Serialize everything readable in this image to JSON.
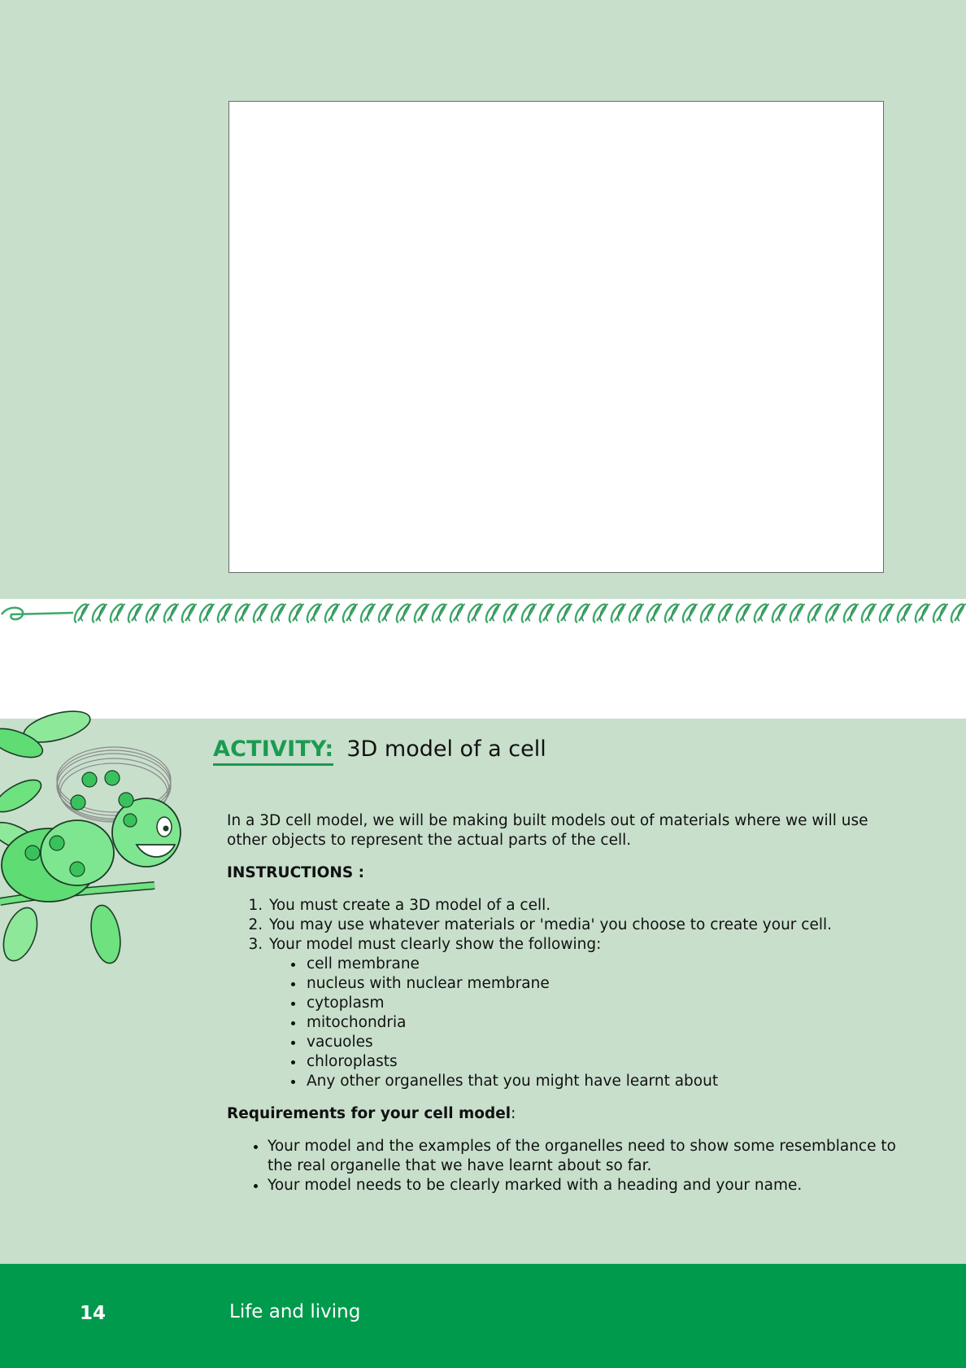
{
  "activity": {
    "label": "ACTIVITY:",
    "title": "3D model of a cell"
  },
  "intro": "In a 3D cell model, we will be making built models out of materials where we will use other objects to represent the actual parts of the cell.",
  "instructions": {
    "heading": "INSTRUCTIONS :",
    "steps": [
      "You must create a 3D model of a cell.",
      "You may use whatever materials or 'media' you choose to create your cell.",
      "Your model must clearly show the following:"
    ],
    "parts": [
      "cell membrane",
      "nucleus with nuclear membrane",
      "cytoplasm",
      "mitochondria",
      "vacuoles",
      "chloroplasts",
      "Any other organelles that you might have learnt about"
    ]
  },
  "requirements": {
    "heading": "Requirements for your cell model",
    "colon": ":",
    "items": [
      "Your model and the examples of the organelles need to show some resemblance to the real organelle that we have learnt about so far.",
      "Your model needs to be clearly marked with a heading and your name."
    ]
  },
  "footer": {
    "page_number": "14",
    "title": "Life and living"
  },
  "colors": {
    "panel_background": "#c8dfcc",
    "accent_green": "#1a9b50",
    "footer_green": "#009a4c"
  },
  "icons": [
    "chain-border-decoration",
    "caterpillar-mascot-illustration"
  ]
}
